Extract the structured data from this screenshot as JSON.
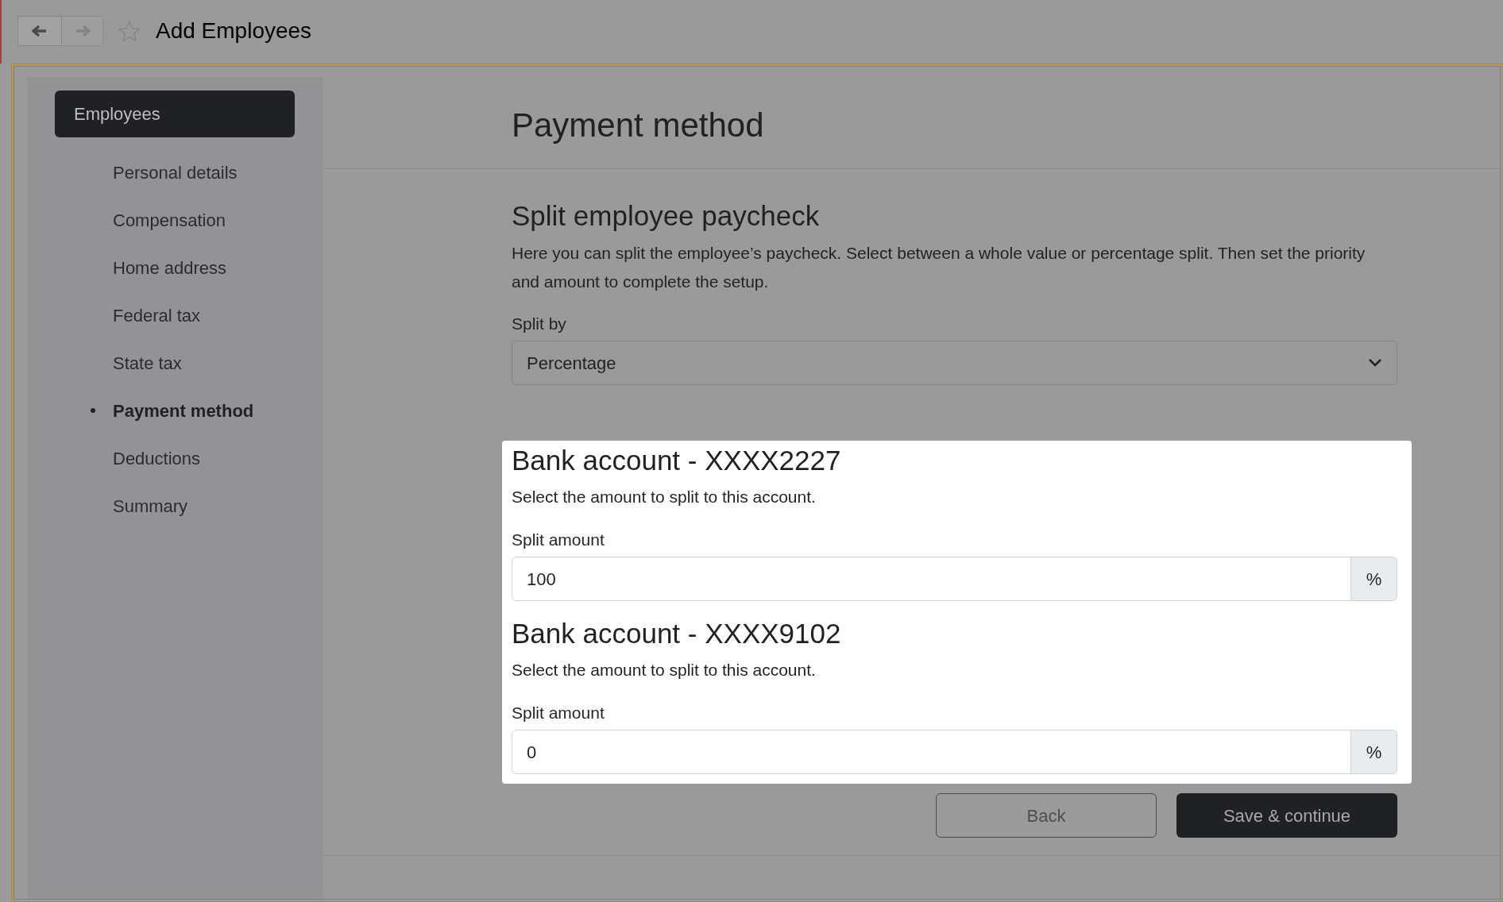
{
  "browser": {
    "title": "Add Employees"
  },
  "sidebar": {
    "header": "Employees",
    "items": [
      {
        "label": "Personal details",
        "selected": false
      },
      {
        "label": "Compensation",
        "selected": false
      },
      {
        "label": "Home address",
        "selected": false
      },
      {
        "label": "Federal tax",
        "selected": false
      },
      {
        "label": "State tax",
        "selected": false
      },
      {
        "label": "Payment method",
        "selected": true
      },
      {
        "label": "Deductions",
        "selected": false
      },
      {
        "label": "Summary",
        "selected": false
      }
    ]
  },
  "page": {
    "title": "Payment method"
  },
  "split": {
    "title": "Split employee paycheck",
    "description": "Here you can split the employee’s paycheck. Select between a whole value or percentage split. Then set the priority and amount to complete the setup.",
    "split_by": {
      "label": "Split by",
      "value": "Percentage"
    }
  },
  "accounts": [
    {
      "title": "Bank account - XXXX2227",
      "description": "Select the amount to split to this account.",
      "field_label": "Split amount",
      "value": "100",
      "unit": "%"
    },
    {
      "title": "Bank account - XXXX9102",
      "description": "Select the amount to split to this account.",
      "field_label": "Split amount",
      "value": "0",
      "unit": "%"
    }
  ],
  "actions": {
    "back": "Back",
    "save": "Save & continue"
  }
}
